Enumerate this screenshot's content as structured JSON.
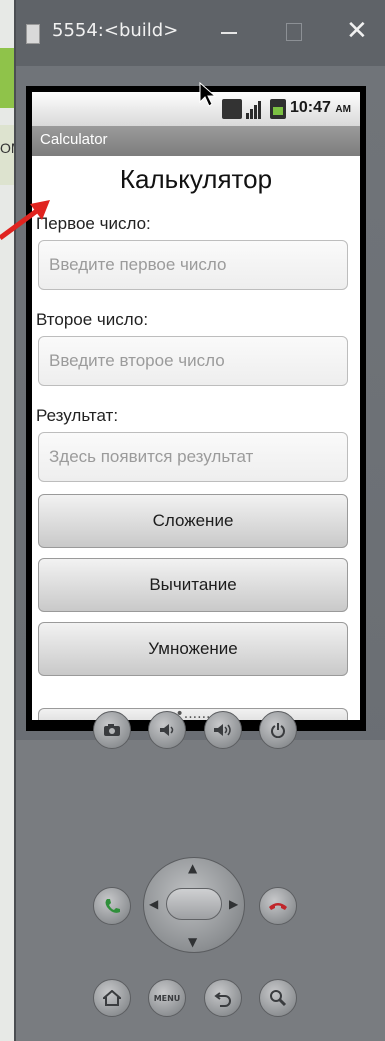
{
  "window": {
    "title": "5554:<build>",
    "minimize_icon": "minimize-icon",
    "maximize_icon": "maximize-icon",
    "close_glyph": "✕"
  },
  "background": {
    "partial_text": "OM"
  },
  "statusbar": {
    "time": "10:47",
    "ampm": "AM",
    "icons": [
      "3g-icon",
      "signal-icon",
      "battery-icon"
    ]
  },
  "app": {
    "title": "Calculator",
    "heading": "Калькулятор",
    "first": {
      "label": "Первое число:",
      "placeholder": "Введите первое число",
      "value": ""
    },
    "second": {
      "label": "Второе число:",
      "placeholder": "Введите второе число",
      "value": ""
    },
    "result": {
      "label": "Результат:",
      "placeholder": "Здесь появится результат",
      "value": ""
    },
    "buttons": {
      "add": "Сложение",
      "subtract": "Вычитание",
      "multiply": "Умножение",
      "partial": "•......"
    }
  },
  "hardware": {
    "camera": "camera-icon",
    "volume_down": "volume-down-icon",
    "volume_up": "volume-up-icon",
    "power": "power-icon",
    "call": "call-icon",
    "end_call": "end-call-icon",
    "home": "home-icon",
    "menu_label": "MENU",
    "back": "back-icon",
    "search": "search-icon"
  },
  "colors": {
    "arrow": "#e0231f",
    "call": "#2f8f3a",
    "end_call": "#c0262b"
  }
}
